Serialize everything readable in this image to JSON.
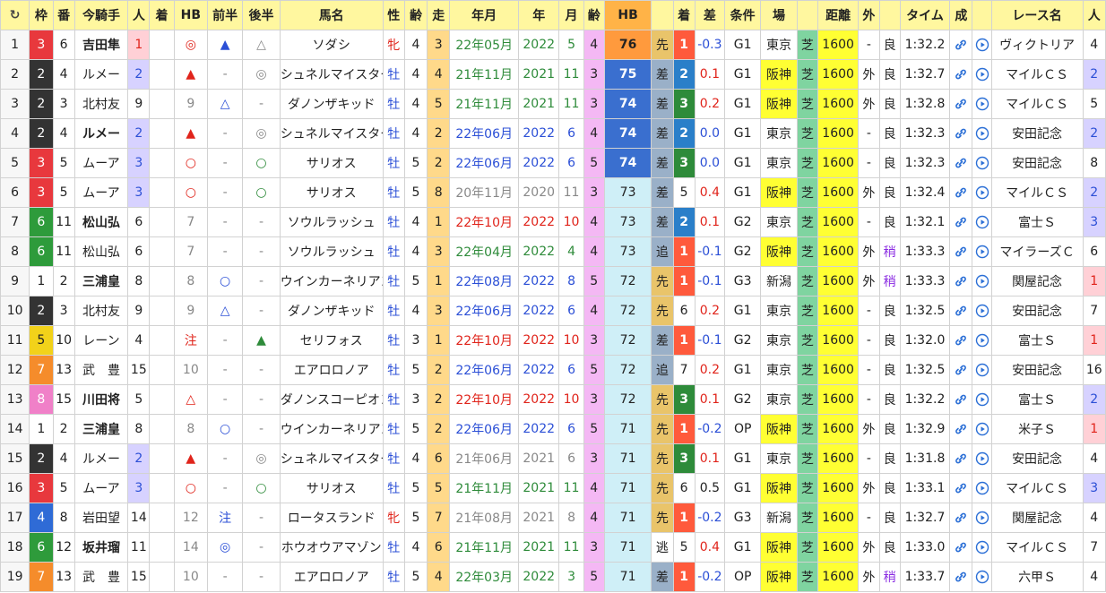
{
  "colors": {
    "waku": [
      "#ffffff",
      "#ffffff",
      "#333333",
      "#e8383d",
      "#2f6bd6",
      "#f2d21a",
      "#2e9b3b",
      "#f58c2b",
      "#f080c8"
    ],
    "waku_fg": [
      "#222",
      "#222",
      "#fff",
      "#fff",
      "#fff",
      "#222",
      "#fff",
      "#fff",
      "#fff"
    ]
  },
  "header": [
    "↻",
    "枠",
    "番",
    "今騎手",
    "人",
    "着",
    "HB",
    "前半",
    "後半",
    "馬名",
    "性",
    "齢",
    "走",
    "年月",
    "年",
    "月",
    "齢",
    "HB",
    "",
    "着",
    "差",
    "条件",
    "場",
    "",
    "距離",
    "外",
    "",
    "タイム",
    "成",
    "",
    "レース名",
    "人"
  ],
  "rows": [
    {
      "no": "1",
      "waku": 3,
      "ban": "6",
      "jockey": "吉田隼",
      "jb": true,
      "pop": "1",
      "popc": "pink",
      "chaku": "",
      "hb": "◎",
      "hbc": "red",
      "zen": "▲",
      "zenc": "blue",
      "kou": "△",
      "kouc": "gray",
      "name": "ソダシ",
      "sex": "牝",
      "sexc": "red",
      "age": "4",
      "run": "3",
      "ym": "22年05月",
      "ymc": "green",
      "y": "2022",
      "m": "5",
      "age2": "4",
      "age2c": "violet",
      "hbv": "76",
      "hbb": "#ff9a3d",
      "kyaku": "先",
      "kb": "#e9c46a",
      "ch": "1",
      "chb": "#ff5a3c",
      "sa": "-0.3",
      "sac": "blue",
      "jo": "G1",
      "ba": "東京",
      "bab": "#fff",
      "cs": "芝",
      "dist": "1600",
      "soto": "-",
      "baba": "良",
      "time": "1:32.2",
      "race": "ヴィクトリア",
      "rpop": "4",
      "rpopb": "#fff"
    },
    {
      "no": "2",
      "waku": 2,
      "ban": "4",
      "jockey": "ルメー",
      "jb": false,
      "pop": "2",
      "popc": "lav",
      "chaku": "",
      "hb": "▲",
      "hbc": "red",
      "zen": "-",
      "zenc": "gray",
      "kou": "◎",
      "kouc": "gray",
      "name": "シュネルマイスター",
      "sex": "牡",
      "sexc": "blue",
      "age": "4",
      "run": "4",
      "ym": "21年11月",
      "ymc": "green",
      "y": "2021",
      "m": "11",
      "age2": "3",
      "age2c": "violet",
      "hbv": "75",
      "hbb": "#3a6fcf",
      "kyaku": "差",
      "kb": "#9ab0c8",
      "ch": "2",
      "chb": "#2a7fc9",
      "sa": "0.1",
      "sac": "red",
      "jo": "G1",
      "ba": "阪神",
      "bab": "#ffff33",
      "cs": "芝",
      "dist": "1600",
      "soto": "外",
      "baba": "良",
      "time": "1:32.7",
      "race": "マイルＣＳ",
      "rpop": "2",
      "rpopb": "#d7d2ff"
    },
    {
      "no": "3",
      "waku": 2,
      "ban": "3",
      "jockey": "北村友",
      "jb": false,
      "pop": "9",
      "popc": "",
      "chaku": "",
      "hb": "9",
      "hbc": "gray",
      "zen": "△",
      "zenc": "blue",
      "kou": "-",
      "kouc": "gray",
      "name": "ダノンザキッド",
      "sex": "牡",
      "sexc": "blue",
      "age": "4",
      "run": "5",
      "ym": "21年11月",
      "ymc": "green",
      "y": "2021",
      "m": "11",
      "age2": "3",
      "age2c": "violet",
      "hbv": "74",
      "hbb": "#3a6fcf",
      "kyaku": "差",
      "kb": "#9ab0c8",
      "ch": "3",
      "chb": "#2e8b3a",
      "sa": "0.2",
      "sac": "red",
      "jo": "G1",
      "ba": "阪神",
      "bab": "#ffff33",
      "cs": "芝",
      "dist": "1600",
      "soto": "外",
      "baba": "良",
      "time": "1:32.8",
      "race": "マイルＣＳ",
      "rpop": "5",
      "rpopb": "#fff"
    },
    {
      "no": "4",
      "waku": 2,
      "ban": "4",
      "jockey": "ルメー",
      "jb": true,
      "pop": "2",
      "popc": "lav",
      "chaku": "",
      "hb": "▲",
      "hbc": "red",
      "zen": "-",
      "zenc": "gray",
      "kou": "◎",
      "kouc": "gray",
      "name": "シュネルマイスター",
      "sex": "牡",
      "sexc": "blue",
      "age": "4",
      "run": "2",
      "ym": "22年06月",
      "ymc": "blue",
      "y": "2022",
      "m": "6",
      "age2": "4",
      "age2c": "violet",
      "hbv": "74",
      "hbb": "#3a6fcf",
      "kyaku": "差",
      "kb": "#9ab0c8",
      "ch": "2",
      "chb": "#2a7fc9",
      "sa": "0.0",
      "sac": "blue",
      "jo": "G1",
      "ba": "東京",
      "bab": "#fff",
      "cs": "芝",
      "dist": "1600",
      "soto": "-",
      "baba": "良",
      "time": "1:32.3",
      "race": "安田記念",
      "rpop": "2",
      "rpopb": "#d7d2ff"
    },
    {
      "no": "5",
      "waku": 3,
      "ban": "5",
      "jockey": "ムーア",
      "jb": false,
      "pop": "3",
      "popc": "lav",
      "chaku": "",
      "hb": "○",
      "hbc": "red",
      "zen": "-",
      "zenc": "gray",
      "kou": "○",
      "kouc": "green",
      "name": "サリオス",
      "sex": "牡",
      "sexc": "blue",
      "age": "5",
      "run": "2",
      "ym": "22年06月",
      "ymc": "blue",
      "y": "2022",
      "m": "6",
      "age2": "5",
      "age2c": "violet",
      "hbv": "74",
      "hbb": "#3a6fcf",
      "kyaku": "差",
      "kb": "#9ab0c8",
      "ch": "3",
      "chb": "#2e8b3a",
      "sa": "0.0",
      "sac": "blue",
      "jo": "G1",
      "ba": "東京",
      "bab": "#fff",
      "cs": "芝",
      "dist": "1600",
      "soto": "-",
      "baba": "良",
      "time": "1:32.3",
      "race": "安田記念",
      "rpop": "8",
      "rpopb": "#fff"
    },
    {
      "no": "6",
      "waku": 3,
      "ban": "5",
      "jockey": "ムーア",
      "jb": false,
      "pop": "3",
      "popc": "lav",
      "chaku": "",
      "hb": "○",
      "hbc": "red",
      "zen": "-",
      "zenc": "gray",
      "kou": "○",
      "kouc": "green",
      "name": "サリオス",
      "sex": "牡",
      "sexc": "blue",
      "age": "5",
      "run": "8",
      "ym": "20年11月",
      "ymc": "gray",
      "y": "2020",
      "m": "11",
      "age2": "3",
      "age2c": "violet",
      "hbv": "73",
      "hbb": "#cfeff7",
      "kyaku": "差",
      "kb": "#9ab0c8",
      "ch": "5",
      "chb": "#fff",
      "sa": "0.4",
      "sac": "red",
      "jo": "G1",
      "ba": "阪神",
      "bab": "#ffff33",
      "cs": "芝",
      "dist": "1600",
      "soto": "外",
      "baba": "良",
      "time": "1:32.4",
      "race": "マイルＣＳ",
      "rpop": "2",
      "rpopb": "#d7d2ff"
    },
    {
      "no": "7",
      "waku": 6,
      "ban": "11",
      "jockey": "松山弘",
      "jb": true,
      "pop": "6",
      "popc": "",
      "chaku": "",
      "hb": "7",
      "hbc": "gray",
      "zen": "-",
      "zenc": "gray",
      "kou": "-",
      "kouc": "gray",
      "name": "ソウルラッシュ",
      "sex": "牡",
      "sexc": "blue",
      "age": "4",
      "run": "1",
      "ym": "22年10月",
      "ymc": "red",
      "y": "2022",
      "m": "10",
      "age2": "4",
      "age2c": "violet",
      "hbv": "73",
      "hbb": "#cfeff7",
      "kyaku": "差",
      "kb": "#9ab0c8",
      "ch": "2",
      "chb": "#2a7fc9",
      "sa": "0.1",
      "sac": "red",
      "jo": "G2",
      "ba": "東京",
      "bab": "#fff",
      "cs": "芝",
      "dist": "1600",
      "soto": "-",
      "baba": "良",
      "time": "1:32.1",
      "race": "富士Ｓ",
      "rpop": "3",
      "rpopb": "#d7d2ff"
    },
    {
      "no": "8",
      "waku": 6,
      "ban": "11",
      "jockey": "松山弘",
      "jb": false,
      "pop": "6",
      "popc": "",
      "chaku": "",
      "hb": "7",
      "hbc": "gray",
      "zen": "-",
      "zenc": "gray",
      "kou": "-",
      "kouc": "gray",
      "name": "ソウルラッシュ",
      "sex": "牡",
      "sexc": "blue",
      "age": "4",
      "run": "3",
      "ym": "22年04月",
      "ymc": "green",
      "y": "2022",
      "m": "4",
      "age2": "4",
      "age2c": "violet",
      "hbv": "73",
      "hbb": "#cfeff7",
      "kyaku": "追",
      "kb": "#9ab0c8",
      "ch": "1",
      "chb": "#ff5a3c",
      "sa": "-0.1",
      "sac": "blue",
      "jo": "G2",
      "ba": "阪神",
      "bab": "#ffff33",
      "cs": "芝",
      "dist": "1600",
      "soto": "外",
      "baba": "稍",
      "time": "1:33.3",
      "race": "マイラーズＣ",
      "rpop": "6",
      "rpopb": "#fff"
    },
    {
      "no": "9",
      "waku": 1,
      "ban": "2",
      "jockey": "三浦皇",
      "jb": true,
      "pop": "8",
      "popc": "",
      "chaku": "",
      "hb": "8",
      "hbc": "gray",
      "zen": "○",
      "zenc": "blue",
      "kou": "-",
      "kouc": "gray",
      "name": "ウインカーネリアン",
      "sex": "牡",
      "sexc": "blue",
      "age": "5",
      "run": "1",
      "ym": "22年08月",
      "ymc": "blue",
      "y": "2022",
      "m": "8",
      "age2": "5",
      "age2c": "violet",
      "hbv": "72",
      "hbb": "#cfeff7",
      "kyaku": "先",
      "kb": "#e9c46a",
      "ch": "1",
      "chb": "#ff5a3c",
      "sa": "-0.1",
      "sac": "blue",
      "jo": "G3",
      "ba": "新潟",
      "bab": "#fff",
      "cs": "芝",
      "dist": "1600",
      "soto": "外",
      "baba": "稍",
      "time": "1:33.3",
      "race": "関屋記念",
      "rpop": "1",
      "rpopb": "#ffd0d6"
    },
    {
      "no": "10",
      "waku": 2,
      "ban": "3",
      "jockey": "北村友",
      "jb": false,
      "pop": "9",
      "popc": "",
      "chaku": "",
      "hb": "9",
      "hbc": "gray",
      "zen": "△",
      "zenc": "blue",
      "kou": "-",
      "kouc": "gray",
      "name": "ダノンザキッド",
      "sex": "牡",
      "sexc": "blue",
      "age": "4",
      "run": "3",
      "ym": "22年06月",
      "ymc": "blue",
      "y": "2022",
      "m": "6",
      "age2": "4",
      "age2c": "violet",
      "hbv": "72",
      "hbb": "#cfeff7",
      "kyaku": "先",
      "kb": "#e9c46a",
      "ch": "6",
      "chb": "#fff",
      "sa": "0.2",
      "sac": "red",
      "jo": "G1",
      "ba": "東京",
      "bab": "#fff",
      "cs": "芝",
      "dist": "1600",
      "soto": "-",
      "baba": "良",
      "time": "1:32.5",
      "race": "安田記念",
      "rpop": "7",
      "rpopb": "#fff"
    },
    {
      "no": "11",
      "waku": 5,
      "ban": "10",
      "jockey": "レーン",
      "jb": false,
      "pop": "4",
      "popc": "",
      "chaku": "",
      "hb": "注",
      "hbc": "red",
      "zen": "-",
      "zenc": "gray",
      "kou": "▲",
      "kouc": "green",
      "name": "セリフォス",
      "sex": "牡",
      "sexc": "blue",
      "age": "3",
      "run": "1",
      "ym": "22年10月",
      "ymc": "red",
      "y": "2022",
      "m": "10",
      "age2": "3",
      "age2c": "violet",
      "hbv": "72",
      "hbb": "#cfeff7",
      "kyaku": "差",
      "kb": "#9ab0c8",
      "ch": "1",
      "chb": "#ff5a3c",
      "sa": "-0.1",
      "sac": "blue",
      "jo": "G2",
      "ba": "東京",
      "bab": "#fff",
      "cs": "芝",
      "dist": "1600",
      "soto": "-",
      "baba": "良",
      "time": "1:32.0",
      "race": "富士Ｓ",
      "rpop": "1",
      "rpopb": "#ffd0d6"
    },
    {
      "no": "12",
      "waku": 7,
      "ban": "13",
      "jockey": "武　豊",
      "jb": false,
      "pop": "15",
      "popc": "",
      "chaku": "",
      "hb": "10",
      "hbc": "gray",
      "zen": "-",
      "zenc": "gray",
      "kou": "-",
      "kouc": "gray",
      "name": "エアロロノア",
      "sex": "牡",
      "sexc": "blue",
      "age": "5",
      "run": "2",
      "ym": "22年06月",
      "ymc": "blue",
      "y": "2022",
      "m": "6",
      "age2": "5",
      "age2c": "violet",
      "hbv": "72",
      "hbb": "#cfeff7",
      "kyaku": "追",
      "kb": "#9ab0c8",
      "ch": "7",
      "chb": "#fff",
      "sa": "0.2",
      "sac": "red",
      "jo": "G1",
      "ba": "東京",
      "bab": "#fff",
      "cs": "芝",
      "dist": "1600",
      "soto": "-",
      "baba": "良",
      "time": "1:32.5",
      "race": "安田記念",
      "rpop": "16",
      "rpopb": "#fff"
    },
    {
      "no": "13",
      "waku": 8,
      "ban": "15",
      "jockey": "川田将",
      "jb": true,
      "pop": "5",
      "popc": "",
      "chaku": "",
      "hb": "△",
      "hbc": "red",
      "zen": "-",
      "zenc": "gray",
      "kou": "-",
      "kouc": "gray",
      "name": "ダノンスコーピオン",
      "sex": "牡",
      "sexc": "blue",
      "age": "3",
      "run": "2",
      "ym": "22年10月",
      "ymc": "red",
      "y": "2022",
      "m": "10",
      "age2": "3",
      "age2c": "violet",
      "hbv": "72",
      "hbb": "#cfeff7",
      "kyaku": "先",
      "kb": "#e9c46a",
      "ch": "3",
      "chb": "#2e8b3a",
      "sa": "0.1",
      "sac": "red",
      "jo": "G2",
      "ba": "東京",
      "bab": "#fff",
      "cs": "芝",
      "dist": "1600",
      "soto": "-",
      "baba": "良",
      "time": "1:32.2",
      "race": "富士Ｓ",
      "rpop": "2",
      "rpopb": "#d7d2ff"
    },
    {
      "no": "14",
      "waku": 1,
      "ban": "2",
      "jockey": "三浦皇",
      "jb": true,
      "pop": "8",
      "popc": "",
      "chaku": "",
      "hb": "8",
      "hbc": "gray",
      "zen": "○",
      "zenc": "blue",
      "kou": "-",
      "kouc": "gray",
      "name": "ウインカーネリアン",
      "sex": "牡",
      "sexc": "blue",
      "age": "5",
      "run": "2",
      "ym": "22年06月",
      "ymc": "blue",
      "y": "2022",
      "m": "6",
      "age2": "5",
      "age2c": "violet",
      "hbv": "71",
      "hbb": "#cfeff7",
      "kyaku": "先",
      "kb": "#e9c46a",
      "ch": "1",
      "chb": "#ff5a3c",
      "sa": "-0.2",
      "sac": "blue",
      "jo": "OP",
      "ba": "阪神",
      "bab": "#ffff33",
      "cs": "芝",
      "dist": "1600",
      "soto": "外",
      "baba": "良",
      "time": "1:32.9",
      "race": "米子Ｓ",
      "rpop": "1",
      "rpopb": "#ffd0d6"
    },
    {
      "no": "15",
      "waku": 2,
      "ban": "4",
      "jockey": "ルメー",
      "jb": false,
      "pop": "2",
      "popc": "lav",
      "chaku": "",
      "hb": "▲",
      "hbc": "red",
      "zen": "-",
      "zenc": "gray",
      "kou": "◎",
      "kouc": "gray",
      "name": "シュネルマイスター",
      "sex": "牡",
      "sexc": "blue",
      "age": "4",
      "run": "6",
      "ym": "21年06月",
      "ymc": "gray",
      "y": "2021",
      "m": "6",
      "age2": "3",
      "age2c": "violet",
      "hbv": "71",
      "hbb": "#cfeff7",
      "kyaku": "先",
      "kb": "#e9c46a",
      "ch": "3",
      "chb": "#2e8b3a",
      "sa": "0.1",
      "sac": "red",
      "jo": "G1",
      "ba": "東京",
      "bab": "#fff",
      "cs": "芝",
      "dist": "1600",
      "soto": "-",
      "baba": "良",
      "time": "1:31.8",
      "race": "安田記念",
      "rpop": "4",
      "rpopb": "#fff"
    },
    {
      "no": "16",
      "waku": 3,
      "ban": "5",
      "jockey": "ムーア",
      "jb": false,
      "pop": "3",
      "popc": "lav",
      "chaku": "",
      "hb": "○",
      "hbc": "red",
      "zen": "-",
      "zenc": "gray",
      "kou": "○",
      "kouc": "green",
      "name": "サリオス",
      "sex": "牡",
      "sexc": "blue",
      "age": "5",
      "run": "5",
      "ym": "21年11月",
      "ymc": "green",
      "y": "2021",
      "m": "11",
      "age2": "4",
      "age2c": "violet",
      "hbv": "71",
      "hbb": "#cfeff7",
      "kyaku": "先",
      "kb": "#e9c46a",
      "ch": "6",
      "chb": "#fff",
      "sa": "0.5",
      "sac": "dark",
      "jo": "G1",
      "ba": "阪神",
      "bab": "#ffff33",
      "cs": "芝",
      "dist": "1600",
      "soto": "外",
      "baba": "良",
      "time": "1:33.1",
      "race": "マイルＣＳ",
      "rpop": "3",
      "rpopb": "#d7d2ff"
    },
    {
      "no": "17",
      "waku": 4,
      "ban": "8",
      "jockey": "岩田望",
      "jb": false,
      "pop": "14",
      "popc": "",
      "chaku": "",
      "hb": "12",
      "hbc": "gray",
      "zen": "注",
      "zenc": "blue",
      "kou": "-",
      "kouc": "gray",
      "name": "ロータスランド",
      "sex": "牝",
      "sexc": "red",
      "age": "5",
      "run": "7",
      "ym": "21年08月",
      "ymc": "gray",
      "y": "2021",
      "m": "8",
      "age2": "4",
      "age2c": "violet",
      "hbv": "71",
      "hbb": "#cfeff7",
      "kyaku": "先",
      "kb": "#e9c46a",
      "ch": "1",
      "chb": "#ff5a3c",
      "sa": "-0.2",
      "sac": "blue",
      "jo": "G3",
      "ba": "新潟",
      "bab": "#fff",
      "cs": "芝",
      "dist": "1600",
      "soto": "-",
      "baba": "良",
      "time": "1:32.7",
      "race": "関屋記念",
      "rpop": "4",
      "rpopb": "#fff"
    },
    {
      "no": "18",
      "waku": 6,
      "ban": "12",
      "jockey": "坂井瑠",
      "jb": true,
      "pop": "11",
      "popc": "",
      "chaku": "",
      "hb": "14",
      "hbc": "gray",
      "zen": "◎",
      "zenc": "blue",
      "kou": "-",
      "kouc": "gray",
      "name": "ホウオウアマゾン",
      "sex": "牡",
      "sexc": "blue",
      "age": "4",
      "run": "6",
      "ym": "21年11月",
      "ymc": "green",
      "y": "2021",
      "m": "11",
      "age2": "3",
      "age2c": "violet",
      "hbv": "71",
      "hbb": "#cfeff7",
      "kyaku": "逃",
      "kb": "#fff",
      "ch": "5",
      "chb": "#fff",
      "sa": "0.4",
      "sac": "red",
      "jo": "G1",
      "ba": "阪神",
      "bab": "#ffff33",
      "cs": "芝",
      "dist": "1600",
      "soto": "外",
      "baba": "良",
      "time": "1:33.0",
      "race": "マイルＣＳ",
      "rpop": "7",
      "rpopb": "#fff"
    },
    {
      "no": "19",
      "waku": 7,
      "ban": "13",
      "jockey": "武　豊",
      "jb": false,
      "pop": "15",
      "popc": "",
      "chaku": "",
      "hb": "10",
      "hbc": "gray",
      "zen": "-",
      "zenc": "gray",
      "kou": "-",
      "kouc": "gray",
      "name": "エアロロノア",
      "sex": "牡",
      "sexc": "blue",
      "age": "5",
      "run": "4",
      "ym": "22年03月",
      "ymc": "green",
      "y": "2022",
      "m": "3",
      "age2": "5",
      "age2c": "violet",
      "hbv": "71",
      "hbb": "#cfeff7",
      "kyaku": "差",
      "kb": "#9ab0c8",
      "ch": "1",
      "chb": "#ff5a3c",
      "sa": "-0.2",
      "sac": "blue",
      "jo": "OP",
      "ba": "阪神",
      "bab": "#ffff33",
      "cs": "芝",
      "dist": "1600",
      "soto": "外",
      "baba": "稍",
      "time": "1:33.7",
      "race": "六甲Ｓ",
      "rpop": "4",
      "rpopb": "#fff"
    }
  ]
}
